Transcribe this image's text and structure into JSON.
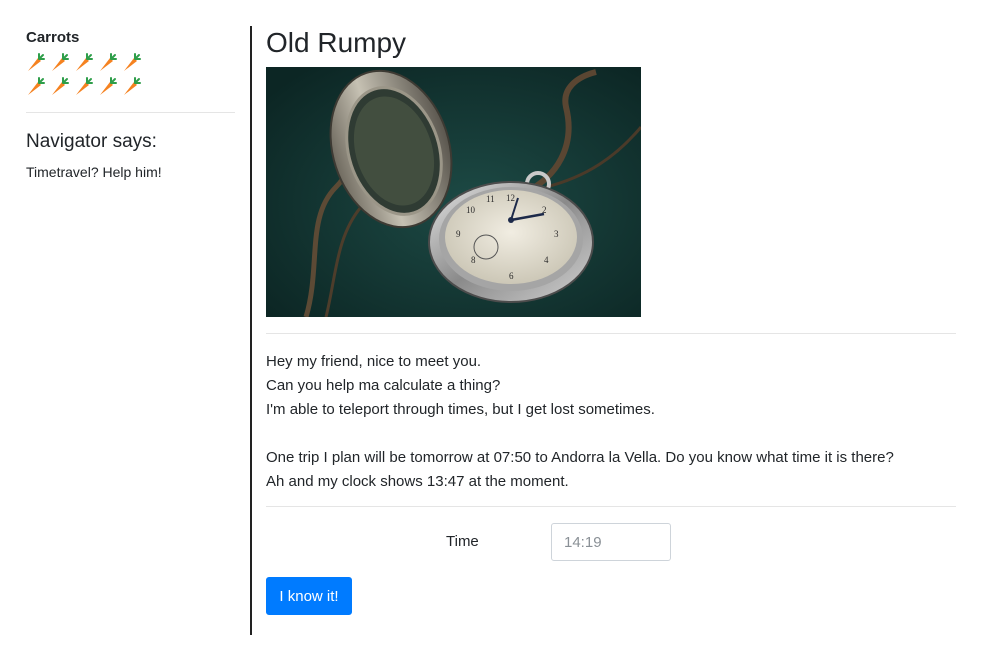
{
  "sidebar": {
    "carrots_title": "Carrots",
    "carrot_count": 10,
    "carrot_icon": "carrot-icon",
    "navigator_heading": "Navigator says:",
    "navigator_text": "Timetravel? Help him!"
  },
  "main": {
    "title": "Old Rumpy",
    "image_description_icon": "pocket-watch-photo",
    "message_lines": [
      "Hey my friend, nice to meet you.",
      "Can you help ma calculate a thing?",
      "I'm able to teleport through times, but I get lost sometimes.",
      "One trip I plan will be tomorrow at 07:50 to Andorra la Vella. Do you know what time it is there?",
      "Ah and my clock shows 13:47 at the moment."
    ]
  },
  "form": {
    "time_label": "Time",
    "time_placeholder": "14:19",
    "time_value": "",
    "submit_label": "I know it!"
  },
  "colors": {
    "primary": "#007bff",
    "text": "#212529",
    "divider": "#e5e5e5",
    "carrot_orange": "#f58220",
    "carrot_green": "#2e9e4a"
  }
}
